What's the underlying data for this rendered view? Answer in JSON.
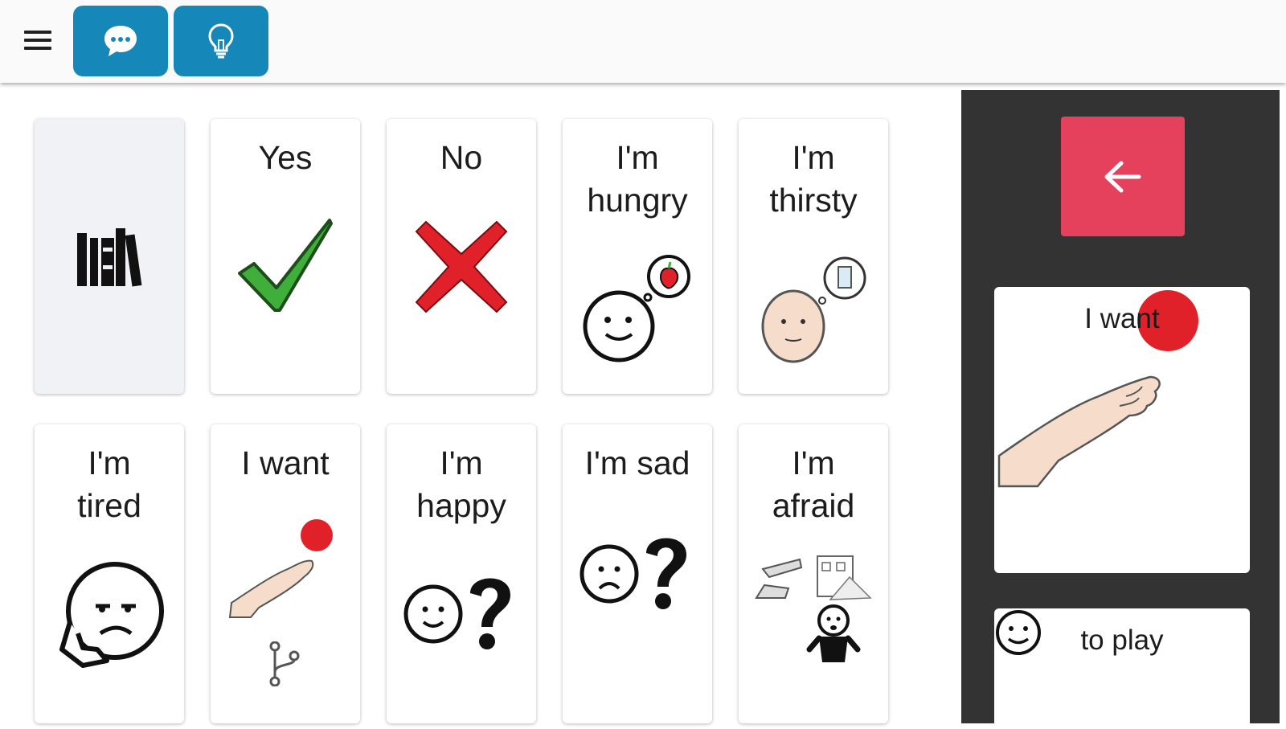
{
  "toolbar": {
    "menu_icon": "hamburger-menu-icon",
    "buttons": [
      {
        "icon": "chat-bubble-icon"
      },
      {
        "icon": "lightbulb-icon"
      }
    ],
    "accent_color": "#1587b8"
  },
  "grid": {
    "tiles": [
      {
        "label": "",
        "icon": "library-books-icon"
      },
      {
        "label": "Yes",
        "icon": "green-checkmark-icon"
      },
      {
        "label": "No",
        "icon": "red-x-icon"
      },
      {
        "label": "I'm\nhungry",
        "icon": "hungry-face-apple-icon"
      },
      {
        "label": "I'm\nthirsty",
        "icon": "thirsty-face-glass-icon"
      },
      {
        "label": "I'm\ntired",
        "icon": "tired-face-icon"
      },
      {
        "label": "I want",
        "icon": "hand-reaching-ball-icon"
      },
      {
        "label": "I'm\nhappy",
        "icon": "happy-face-question-icon"
      },
      {
        "label": "I'm sad",
        "icon": "sad-face-question-icon"
      },
      {
        "label": "I'm\nafraid",
        "icon": "afraid-person-icon"
      }
    ]
  },
  "sidebar": {
    "back_icon": "arrow-left-icon",
    "back_color": "#e5405c",
    "sentence": [
      {
        "label": "I want",
        "icon": "hand-reaching-ball-icon"
      },
      {
        "label": "to play",
        "icon": "smiley-face-icon"
      }
    ]
  }
}
